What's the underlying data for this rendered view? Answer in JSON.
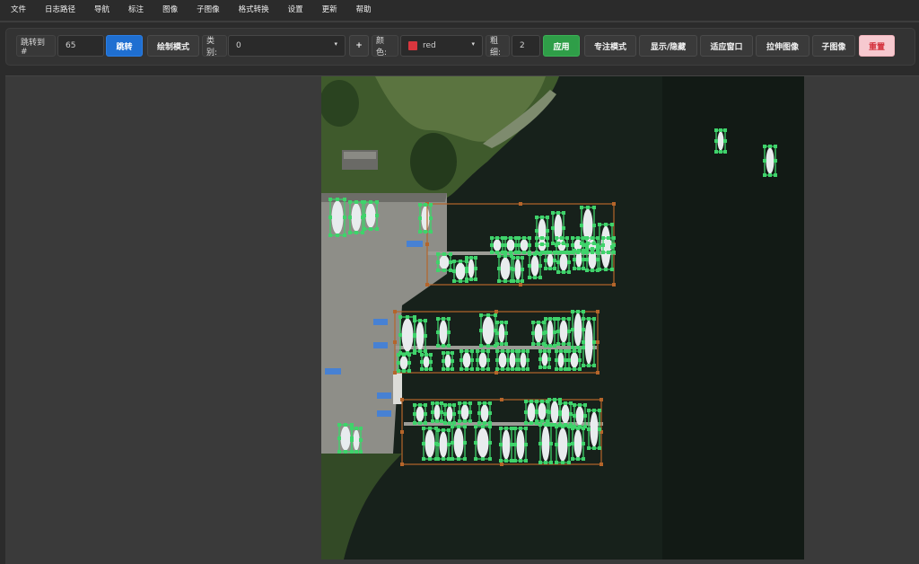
{
  "menu": [
    "文件",
    "日志路径",
    "导航",
    "标注",
    "图像",
    "子图像",
    "格式转换",
    "设置",
    "更新",
    "帮助"
  ],
  "toolbar": {
    "jump_label": "跳转到 #",
    "jump_value": "65",
    "jump_button": "跳转",
    "draw_mode_button": "绘制模式",
    "class_label": "类别:",
    "class_value": "0",
    "add_button": "+",
    "color_label": "颜色:",
    "color_value": "red",
    "color_hex": "#d9363e",
    "thickness_label": "粗细:",
    "thickness_value": "2",
    "apply_button": "应用",
    "focus_button": "专注模式",
    "show_hide_button": "显示/隐藏",
    "fit_window_button": "适应窗口",
    "stretch_button": "拉伸图像",
    "sub_image_button": "子图像",
    "reset_button": "重置"
  },
  "canvas": {
    "annotation_color": "#3fd36b",
    "group_box_color": "#b5652a",
    "vehicle_box_color": "#3b7fe0"
  }
}
